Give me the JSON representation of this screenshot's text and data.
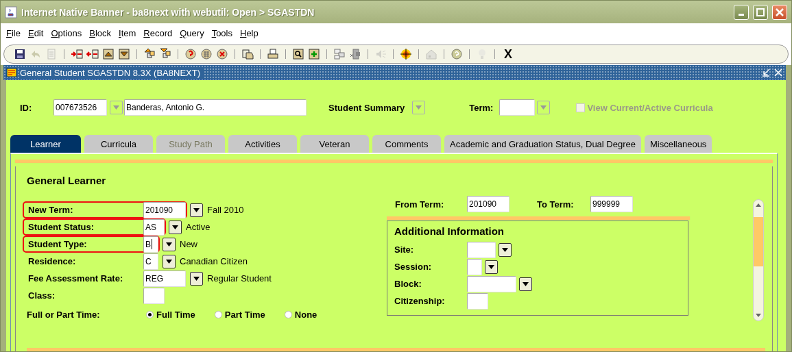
{
  "window": {
    "title": "Internet Native Banner - ba8next with webutil:  Open > SGASTDN"
  },
  "menu": [
    "File",
    "Edit",
    "Options",
    "Block",
    "Item",
    "Record",
    "Query",
    "Tools",
    "Help"
  ],
  "toolbar": {
    "groups": [
      [
        {
          "disabled": false
        },
        {
          "disabled": true
        },
        {
          "disabled": true
        }
      ],
      [
        {
          "disabled": false
        },
        {
          "disabled": false
        },
        {
          "disabled": false
        },
        {
          "disabled": false
        }
      ],
      [
        {
          "disabled": false
        },
        {
          "disabled": false
        }
      ],
      [
        {
          "disabled": false
        },
        {
          "disabled": false
        },
        {
          "disabled": false
        }
      ],
      [
        {
          "disabled": false
        }
      ],
      [
        {
          "disabled": false
        }
      ],
      [
        {
          "disabled": false
        },
        {
          "disabled": false
        }
      ],
      [
        {
          "disabled": false
        },
        {
          "disabled": false
        }
      ],
      [
        {
          "disabled": true
        }
      ],
      [
        {
          "disabled": false
        }
      ],
      [
        {
          "disabled": true
        }
      ],
      [
        {
          "disabled": false
        }
      ],
      [
        {
          "disabled": true
        }
      ]
    ],
    "exit_label": "X"
  },
  "form": {
    "title": "General Student  SGASTDN  8.3X  (BA8NEXT)"
  },
  "key_block": {
    "id_label": "ID:",
    "id_value": "007673526",
    "name_value": "Banderas, Antonio G.",
    "summary_label": "Student Summary",
    "term_label": "Term:",
    "view_current": {
      "label": "View Current/Active Curricula",
      "checked": false,
      "disabled": true
    }
  },
  "tabs": [
    {
      "label": "Learner",
      "selected": true,
      "disabled": false
    },
    {
      "label": "Curricula",
      "selected": false,
      "disabled": false
    },
    {
      "label": "Study Path",
      "selected": false,
      "disabled": true
    },
    {
      "label": "Activities",
      "selected": false,
      "disabled": false
    },
    {
      "label": "Veteran",
      "selected": false,
      "disabled": false
    },
    {
      "label": "Comments",
      "selected": false,
      "disabled": false
    },
    {
      "label": "Academic and Graduation Status, Dual Degree",
      "selected": false,
      "disabled": false
    },
    {
      "label": "Miscellaneous",
      "selected": false,
      "disabled": false
    }
  ],
  "section_title": "General Learner",
  "fields": [
    {
      "label": "New Term:",
      "value": "201090",
      "dropdown": true,
      "description": "Fall 2010",
      "highlighted": true
    },
    {
      "label": "Student Status:",
      "value": "AS",
      "dropdown": true,
      "description": "Active",
      "highlighted": true
    },
    {
      "label": "Student Type:",
      "value": "B",
      "dropdown": true,
      "description": "New",
      "highlighted": true,
      "focused": true
    },
    {
      "label": "Residence:",
      "value": "C",
      "dropdown": true,
      "description": "Canadian Citizen",
      "highlighted": false
    },
    {
      "label": "Fee Assessment Rate:",
      "value": "REG",
      "dropdown": true,
      "description": "Regular Student",
      "highlighted": false
    },
    {
      "label": "Class:",
      "dropdown": false,
      "highlighted": false
    }
  ],
  "full_or_part": {
    "label": "Full or Part Time:",
    "options": [
      {
        "label": "Full Time",
        "selected": true
      },
      {
        "label": "Part Time",
        "selected": false
      },
      {
        "label": "None",
        "selected": false
      }
    ]
  },
  "term_range": {
    "from_label": "From Term:",
    "from_value": "201090",
    "to_label": "To Term:",
    "to_value": "999999"
  },
  "additional": {
    "title": "Additional Information",
    "fields": [
      {
        "label": "Site:",
        "dropdown": true
      },
      {
        "label": "Session:",
        "dropdown": true
      },
      {
        "label": "Block:",
        "dropdown": true
      },
      {
        "label": "Citizenship:",
        "dropdown": false
      }
    ]
  }
}
